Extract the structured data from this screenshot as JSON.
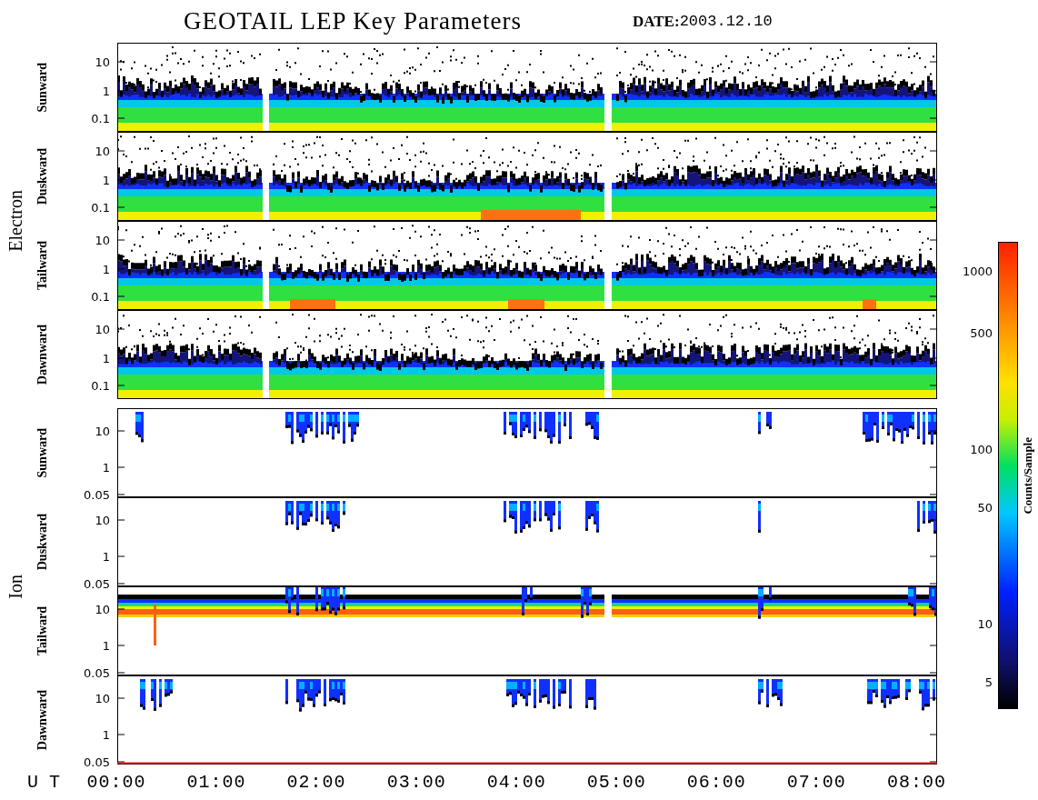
{
  "title": "GEOTAIL LEP Key Parameters",
  "date_label": "DATE:",
  "date": "2003.12.10",
  "groups": [
    {
      "name": "Electron",
      "panels": [
        {
          "label": "Sunward",
          "kind": "electron",
          "yticks": [
            "10",
            "1",
            "0.1"
          ]
        },
        {
          "label": "Duskward",
          "kind": "electron",
          "yticks": [
            "10",
            "1",
            "0.1"
          ]
        },
        {
          "label": "Tailward",
          "kind": "electron",
          "yticks": [
            "10",
            "1",
            "0.1"
          ]
        },
        {
          "label": "Dawnward",
          "kind": "electron",
          "yticks": [
            "10",
            "1",
            "0.1"
          ]
        }
      ]
    },
    {
      "name": "Ion",
      "panels": [
        {
          "label": "Sunward",
          "kind": "sparse",
          "yticks": [
            "10",
            "1",
            "0.05"
          ]
        },
        {
          "label": "Duskward",
          "kind": "sparse",
          "yticks": [
            "10",
            "1",
            "0.05"
          ]
        },
        {
          "label": "Tailward",
          "kind": "band",
          "yticks": [
            "10",
            "1",
            "0.05"
          ]
        },
        {
          "label": "Dawnward",
          "kind": "sparse",
          "yticks": [
            "10",
            "1",
            "0.05"
          ]
        }
      ]
    }
  ],
  "xaxis": {
    "label": "U T",
    "ticks": [
      "00:00",
      "01:00",
      "02:00",
      "03:00",
      "04:00",
      "05:00",
      "06:00",
      "07:00",
      "08:00"
    ]
  },
  "colorbar": {
    "label": "Counts/Sample",
    "ticks": [
      "1000",
      "500",
      "100",
      "50",
      "10",
      "5"
    ]
  }
}
